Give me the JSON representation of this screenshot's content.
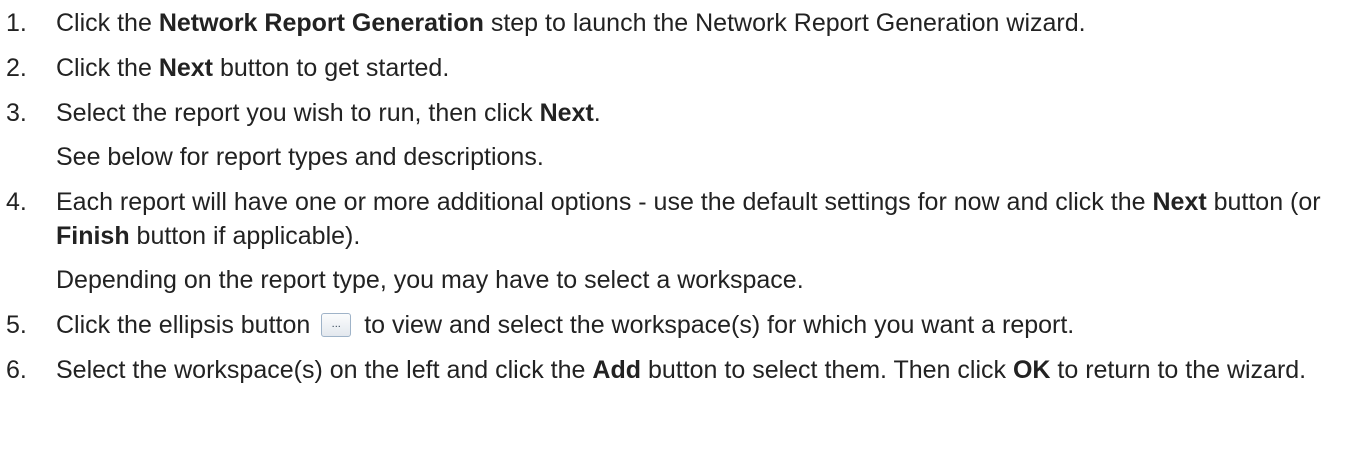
{
  "steps": [
    {
      "num": "1.",
      "t1": "Click the ",
      "b1": "Network Report Generation",
      "t2": " step to launch the Network Report Generation wizard."
    },
    {
      "num": "2.",
      "t1": "Click the ",
      "b1": "Next",
      "t2": " button to get started."
    },
    {
      "num": "3.",
      "t1": "Select the report you wish to run, then click ",
      "b1": "Next",
      "t2": ".",
      "sub": "See below for report types and descriptions."
    },
    {
      "num": "4.",
      "t1": "Each report will have one or more additional options - use the default settings for now and click the ",
      "b1": "Next",
      "t2": " button (or ",
      "b2": "Finish",
      "t3": " button if applicable).",
      "sub": "Depending on the report type, you may have to select a workspace."
    },
    {
      "num": "5.",
      "t1": "Click the ellipsis button",
      "icon": "ellipsis-button-icon",
      "icon_text": "...",
      "t2": " to view and select the workspace(s) for which you want a report."
    },
    {
      "num": "6.",
      "t1": "Select the workspace(s) on the left and click the ",
      "b1": "Add",
      "t2": " button to select them. Then click ",
      "b2": "OK",
      "t3": " to return to the wizard."
    }
  ]
}
